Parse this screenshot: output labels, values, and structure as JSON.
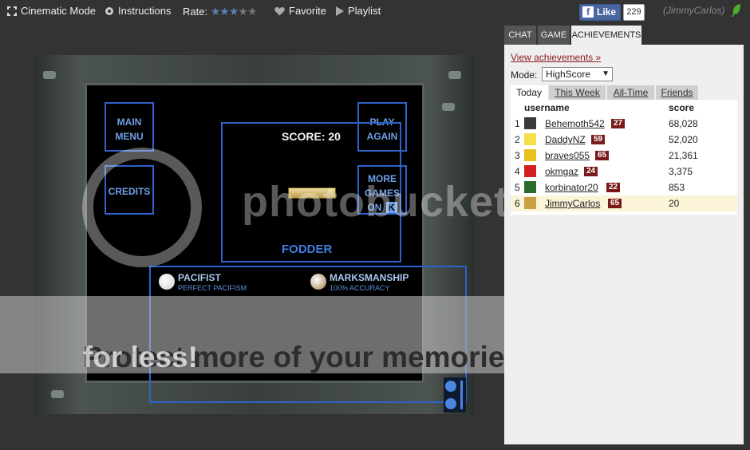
{
  "topbar": {
    "cinematic": "Cinematic Mode",
    "instructions": "Instructions",
    "rate_label": "Rate:",
    "rating": 3,
    "rating_max": 5,
    "favorite": "Favorite",
    "playlist": "Playlist",
    "fb_like": "Like",
    "fb_count": "229",
    "username": "(JimmyCarlos)"
  },
  "game": {
    "main_menu": "MAIN MENU",
    "play_again": "PLAY AGAIN",
    "credits": "CREDITS",
    "more_games": "MORE GAMES ON",
    "more_games_logo": "K",
    "score": "SCORE: 20",
    "rank_title": "FODDER",
    "achievements": [
      {
        "name": "PACIFIST",
        "desc": "PERFECT PACIFISM",
        "color": "#cfcfcf"
      },
      {
        "name": "MARKSMANSHIP",
        "desc": "100% ACCURACY",
        "color": "#a47a4a"
      }
    ]
  },
  "watermark": {
    "logo_text": "photobucket",
    "banner": "Protect more of your memories",
    "banner_tail": " for less!"
  },
  "sidebar": {
    "tabs": [
      "CHAT",
      "GAME",
      "ACHIEVEMENTS"
    ],
    "active_tab": 2,
    "view_link": "View achievements »",
    "mode_label": "Mode:",
    "mode_value": "HighScore",
    "sub_tabs": [
      "Today",
      "This Week",
      "All-Time",
      "Friends"
    ],
    "active_sub_tab": 0,
    "col_user": "username",
    "col_score": "score",
    "rows": [
      {
        "rank": "1",
        "user": "Behemoth542",
        "level": "27",
        "score": "68,028",
        "avatar": "#3a3a3a"
      },
      {
        "rank": "2",
        "user": "DaddyNZ",
        "level": "59",
        "score": "52,020",
        "avatar": "#f5e04a"
      },
      {
        "rank": "3",
        "user": "braves055",
        "level": "65",
        "score": "21,361",
        "avatar": "#e8c020"
      },
      {
        "rank": "4",
        "user": "okmgaz",
        "level": "24",
        "score": "3,375",
        "avatar": "#d02020"
      },
      {
        "rank": "5",
        "user": "korbinator20",
        "level": "22",
        "score": "853",
        "avatar": "#2a6a2a"
      },
      {
        "rank": "6",
        "user": "JimmyCarlos",
        "level": "65",
        "score": "20",
        "avatar": "#c9a040"
      }
    ]
  }
}
